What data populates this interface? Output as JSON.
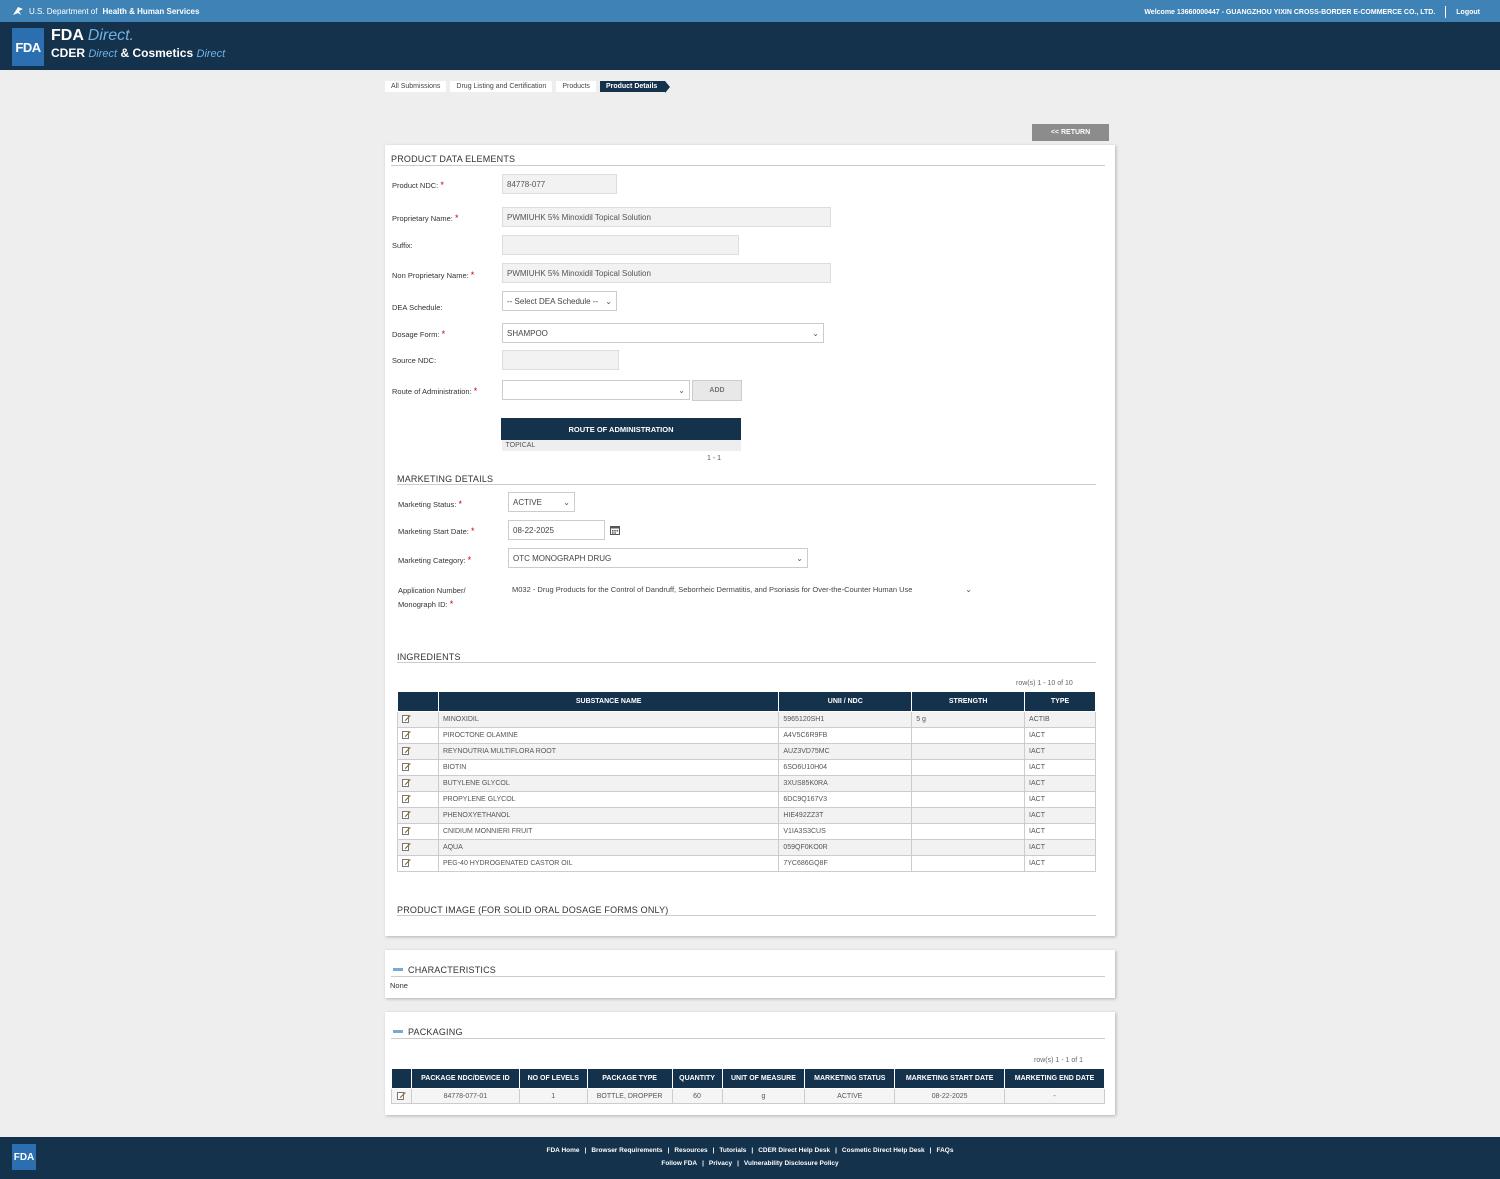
{
  "top_bar": {
    "dept_prefix": "U.S. Department of",
    "dept_name": "Health & Human Services",
    "welcome": "Welcome 13660000447 - GUANGZHOU YIXIN CROSS-BORDER E-COMMERCE CO., LTD.",
    "logout": "Logout"
  },
  "brand": {
    "logo": "FDA",
    "line1_bold": "FDA",
    "line1_italic": "Direct.",
    "line2_cder": "CDER",
    "line2_direct1": "Direct",
    "line2_amp": "&",
    "line2_cosmetics": "Cosmetics",
    "line2_direct2": "Direct"
  },
  "breadcrumb": [
    "All Submissions",
    "Drug Listing and Certification",
    "Products",
    "Product Details"
  ],
  "return_label": "<< RETURN",
  "product": {
    "section_title": "PRODUCT DATA ELEMENTS",
    "ndc_label": "Product NDC:",
    "ndc_value": "84778-077",
    "proprietary_label": "Proprietary Name:",
    "proprietary_value": "PWMIUHK 5% Minoxidil Topical Solution",
    "suffix_label": "Suffix:",
    "suffix_value": "",
    "nonprop_label": "Non Proprietary Name:",
    "nonprop_value": "PWMIUHK 5% Minoxidil Topical Solution",
    "dea_label": "DEA Schedule:",
    "dea_value": "-- Select DEA Schedule --",
    "dosage_label": "Dosage Form:",
    "dosage_value": "SHAMPOO",
    "source_label": "Source NDC:",
    "source_value": "",
    "route_label": "Route of Administration:",
    "route_value": "",
    "add_label": "ADD",
    "route_table_header": "ROUTE OF ADMINISTRATION",
    "route_rows": [
      "TOPICAL"
    ],
    "route_count": "1 - 1"
  },
  "marketing": {
    "section_title": "MARKETING DETAILS",
    "status_label": "Marketing Status:",
    "status_value": "ACTIVE",
    "start_label": "Marketing Start Date:",
    "start_value": "08-22-2025",
    "category_label": "Marketing Category:",
    "category_value": "OTC MONOGRAPH DRUG",
    "app_label_line1": "Application Number/",
    "app_label_line2": "Monograph ID:",
    "app_value": "M032 - Drug Products for the Control of Dandruff, Seborrheic Dermatitis, and Psoriasis for Over-the-Counter Human Use"
  },
  "ingredients": {
    "section_title": "INGREDIENTS",
    "rows_count": "row(s) 1 - 10 of 10",
    "headers": [
      "SUBSTANCE NAME",
      "UNII / NDC",
      "STRENGTH",
      "TYPE"
    ],
    "rows": [
      [
        "MINOXIDIL",
        "5965120SH1",
        "5 g",
        "ACTIB"
      ],
      [
        "PIROCTONE OLAMINE",
        "A4V5C6R9FB",
        "",
        "IACT"
      ],
      [
        "REYNOUTRIA MULTIFLORA ROOT",
        "AUZ3VD75MC",
        "",
        "IACT"
      ],
      [
        "BIOTIN",
        "6SO6U10H04",
        "",
        "IACT"
      ],
      [
        "BUTYLENE GLYCOL",
        "3XUS85K0RA",
        "",
        "IACT"
      ],
      [
        "PROPYLENE GLYCOL",
        "6DC9Q167V3",
        "",
        "IACT"
      ],
      [
        "PHENOXYETHANOL",
        "HIE492ZZ3T",
        "",
        "IACT"
      ],
      [
        "CNIDIUM MONNIERI FRUIT",
        "V1IA3S3CUS",
        "",
        "IACT"
      ],
      [
        "AQUA",
        "059QF0KO0R",
        "",
        "IACT"
      ],
      [
        "PEG-40 HYDROGENATED CASTOR OIL",
        "7YC686GQ8F",
        "",
        "IACT"
      ]
    ]
  },
  "product_image_title": "PRODUCT IMAGE (FOR SOLID ORAL DOSAGE FORMS ONLY)",
  "characteristics": {
    "title": "CHARACTERISTICS",
    "value": "None"
  },
  "packaging": {
    "title": "PACKAGING",
    "rows_count": "row(s) 1 - 1 of 1",
    "headers": [
      "PACKAGE NDC/DEVICE ID",
      "NO OF LEVELS",
      "PACKAGE TYPE",
      "QUANTITY",
      "UNIT OF MEASURE",
      "MARKETING STATUS",
      "MARKETING START DATE",
      "MARKETING END DATE"
    ],
    "rows": [
      [
        "84778-077-01",
        "1",
        "BOTTLE, DROPPER",
        "60",
        "g",
        "ACTIVE",
        "08-22-2025",
        "-"
      ]
    ]
  },
  "footer": {
    "logo": "FDA",
    "links_row1": [
      "FDA Home",
      "Browser Requirements",
      "Resources",
      "Tutorials",
      "CDER Direct Help Desk",
      "Cosmetic Direct Help Desk",
      "FAQs"
    ],
    "links_row2": [
      "Follow FDA",
      "Privacy",
      "Vulnerability Disclosure Policy"
    ]
  },
  "colors": {
    "header_blue": "#3f82b5",
    "navy": "#15324d",
    "required_red": "#cc0000"
  },
  "icons": [
    "hhs-eagle-icon",
    "chevron-down-icon",
    "calendar-icon",
    "edit-icon",
    "collapse-minus-icon"
  ]
}
